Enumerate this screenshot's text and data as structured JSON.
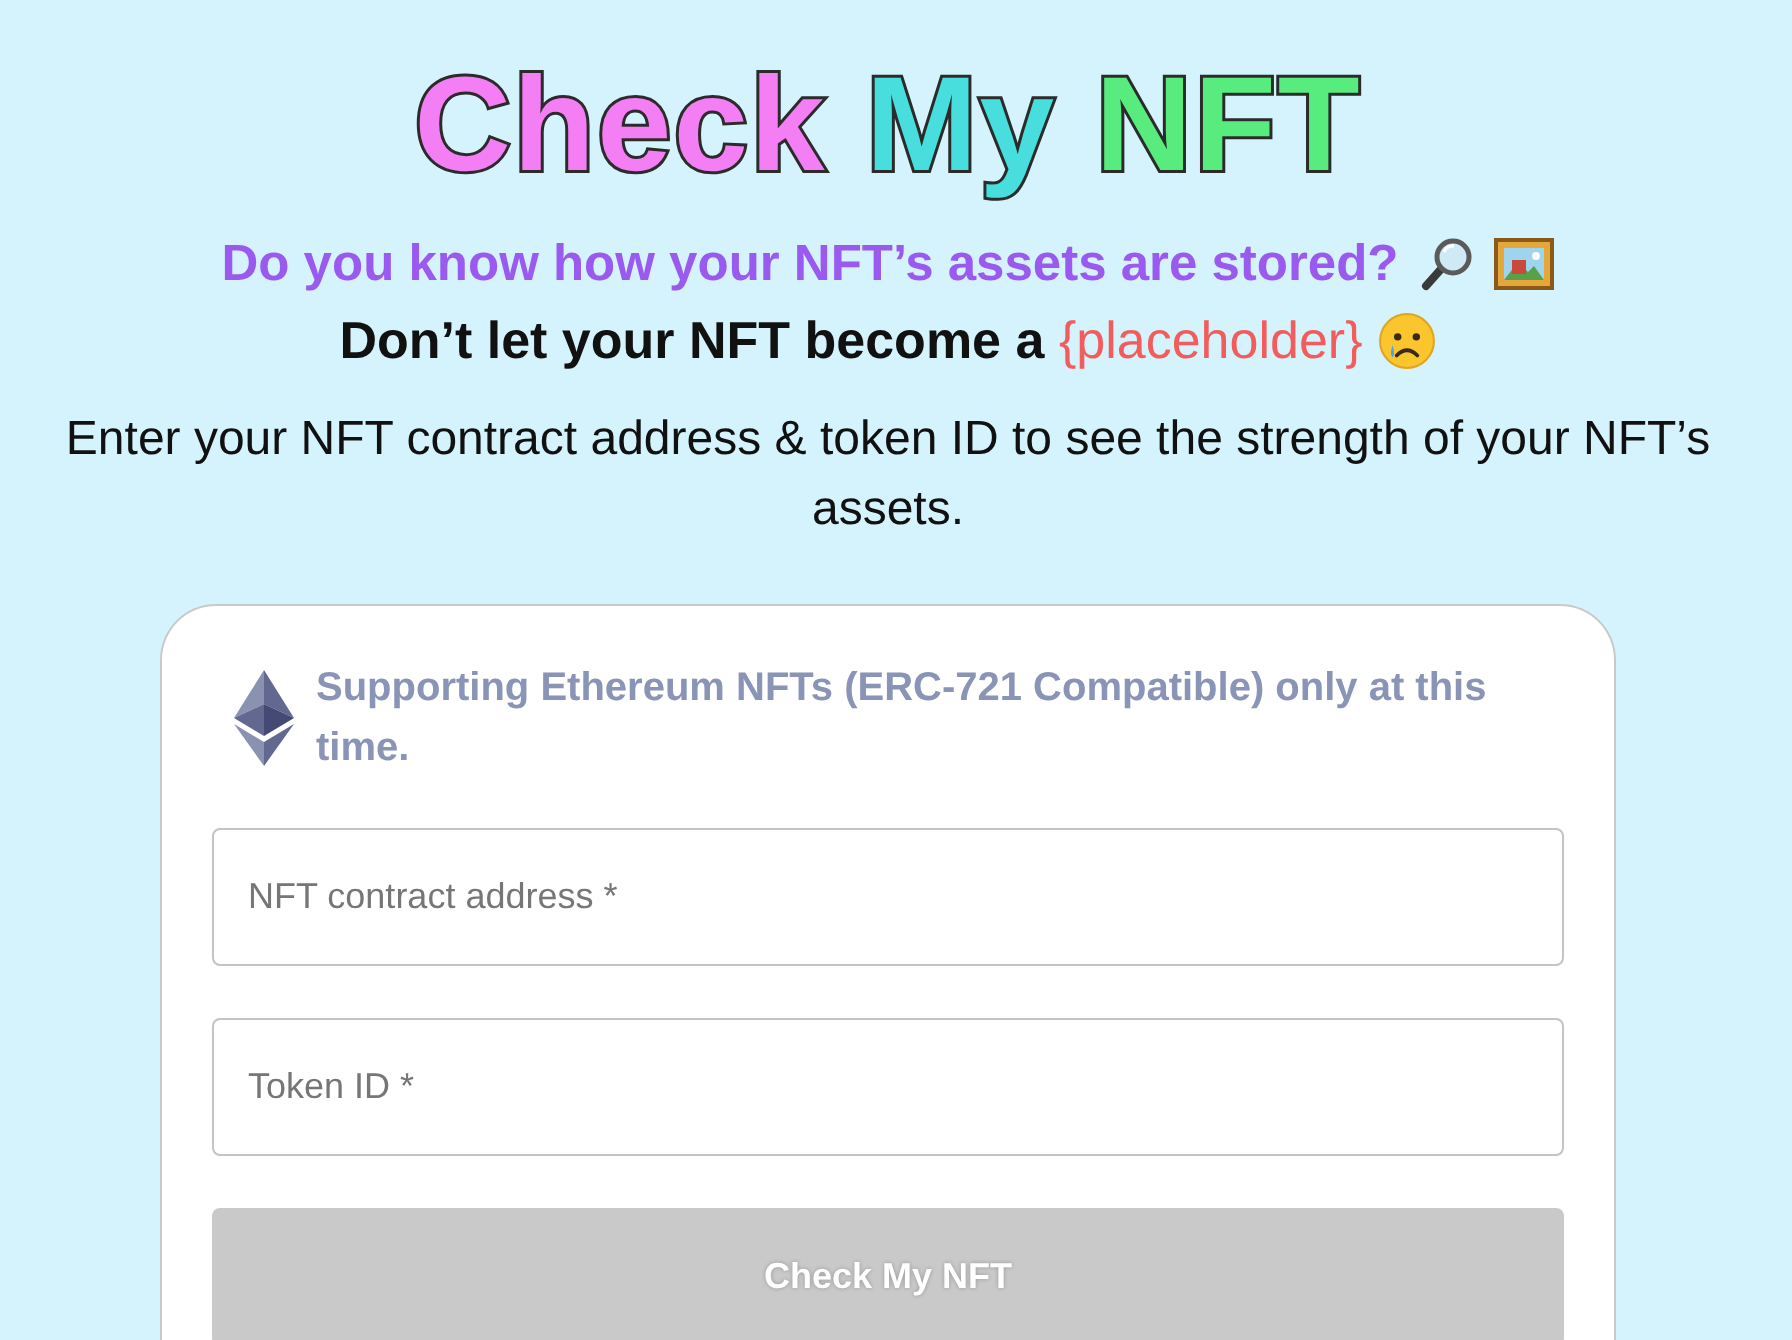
{
  "title": {
    "words": [
      {
        "text": "Check",
        "color": "#f47ff4"
      },
      {
        "text": "My",
        "color": "#48dede"
      },
      {
        "text": "NFT",
        "color": "#58ec7e"
      }
    ]
  },
  "question": "Do you know how your NFT’s assets are stored?",
  "warning": {
    "text": "Don’t let your NFT become a",
    "highlight": "{placeholder}"
  },
  "description": "Enter your NFT contract address & token ID to see the strength of your NFT’s assets.",
  "form": {
    "notice": "Supporting Ethereum NFTs (ERC-721 Compatible) only at this time.",
    "fields": [
      {
        "placeholder": "NFT contract address *"
      },
      {
        "placeholder": "Token ID *"
      }
    ],
    "submit": {
      "label": "Check My NFT",
      "disabled": true
    }
  }
}
